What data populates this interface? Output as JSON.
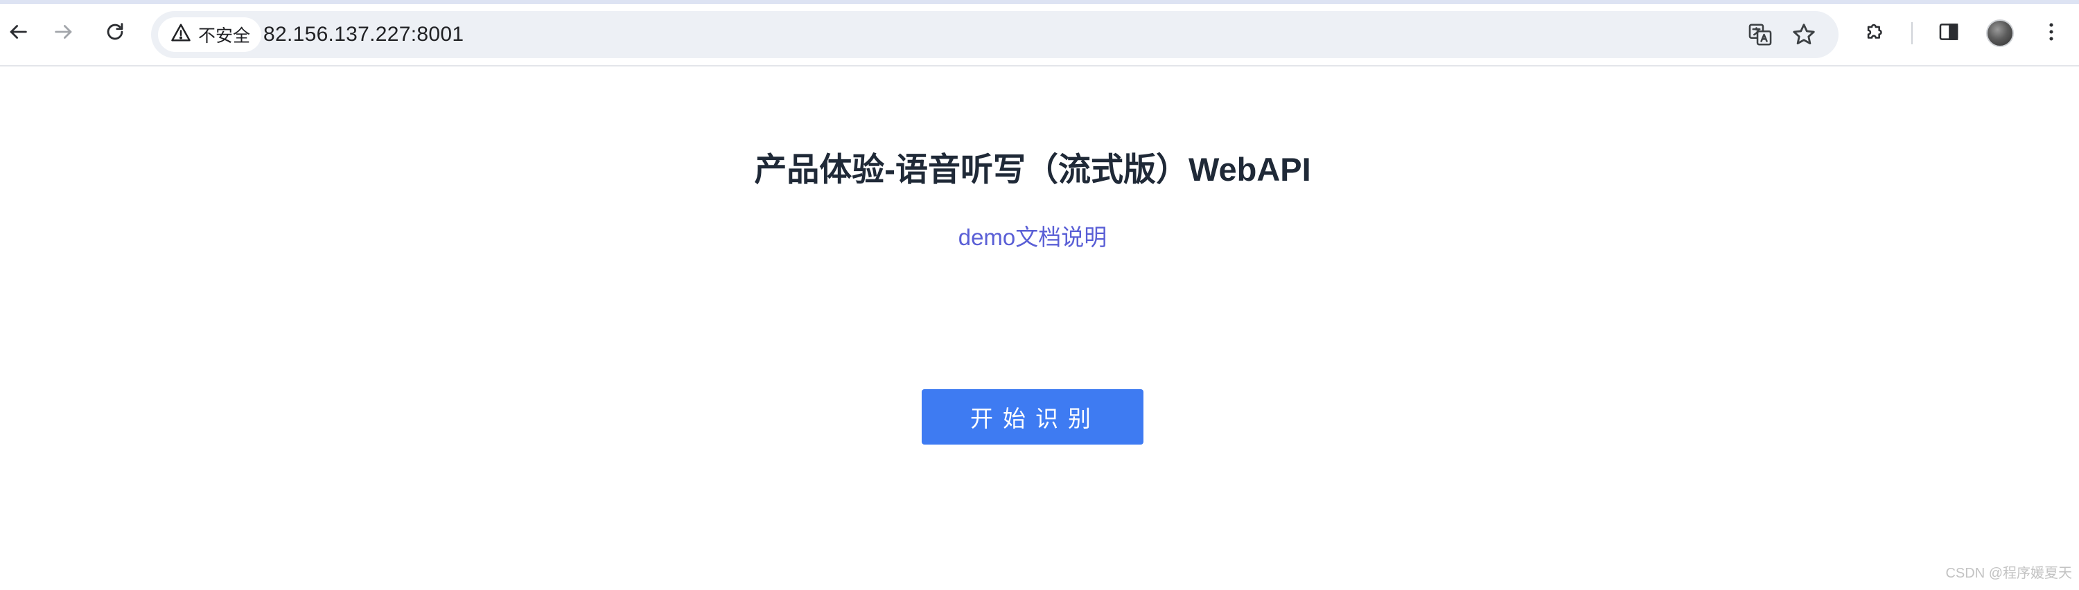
{
  "browser": {
    "security_label": "不安全",
    "url": "82.156.137.227:8001",
    "icons": {
      "back": "arrow-left-icon",
      "forward": "arrow-right-icon",
      "reload": "reload-icon",
      "security": "warning-triangle-icon",
      "translate": "translate-icon",
      "bookmark": "star-icon",
      "extensions": "puzzle-piece-icon",
      "side_panel": "side-panel-icon",
      "profile": "avatar",
      "menu": "kebab-menu-icon"
    }
  },
  "page": {
    "title": "产品体验-语音听写（流式版）WebAPI",
    "doc_link": "demo文档说明",
    "start_button": "开始识别",
    "watermark": "CSDN @程序媛夏天"
  },
  "colors": {
    "link": "#5a5fd6",
    "button": "#3e7bf2",
    "title": "#1f2937"
  }
}
